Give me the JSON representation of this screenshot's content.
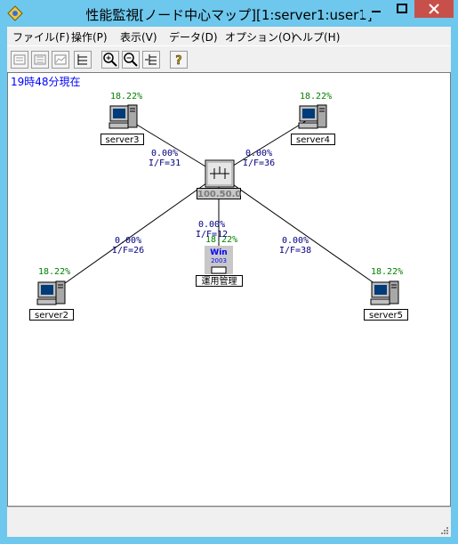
{
  "window": {
    "title": "性能監視[ノード中心マップ][1:server1:user1]",
    "colors": {
      "frame": "#6ec7ec",
      "close": "#c7504a",
      "timestamp": "#0000ff",
      "util": "#008000",
      "link": "#00007f"
    }
  },
  "menu": {
    "items": [
      "ファイル(F)",
      "操作(P)",
      "表示(V)",
      "データ(D)",
      "オプション(O)",
      "ヘルプ(H)"
    ]
  },
  "toolbar": {
    "buttons": [
      "list-view-icon",
      "detail-view-icon",
      "graph-view-icon",
      "tree-expand-icon",
      "zoom-in-icon",
      "zoom-out-icon",
      "tree-collapse-icon",
      "help-icon"
    ]
  },
  "map": {
    "timestamp": "19時48分現在",
    "hub": {
      "label": "100.50.0",
      "icon": "router-icon"
    },
    "nodes": {
      "server3": {
        "label": "server3",
        "util": "18.22%"
      },
      "server4": {
        "label": "server4",
        "util": "18.22%"
      },
      "server2": {
        "label": "server2",
        "util": "18.22%"
      },
      "server5": {
        "label": "server5",
        "util": "18.22%"
      },
      "mgmt": {
        "label": "運用管理",
        "util": "18.22%",
        "badge": "Win",
        "badge_year": "2003"
      }
    },
    "links": {
      "server3": {
        "util": "0.00%",
        "iface": "I/F=31"
      },
      "server4": {
        "util": "0.00%",
        "iface": "I/F=36"
      },
      "mgmt": {
        "util": "0.00%",
        "iface": "I/F=12"
      },
      "server2": {
        "util": "0.00%",
        "iface": "I/F=26"
      },
      "server5": {
        "util": "0.00%",
        "iface": "I/F=38"
      }
    }
  }
}
